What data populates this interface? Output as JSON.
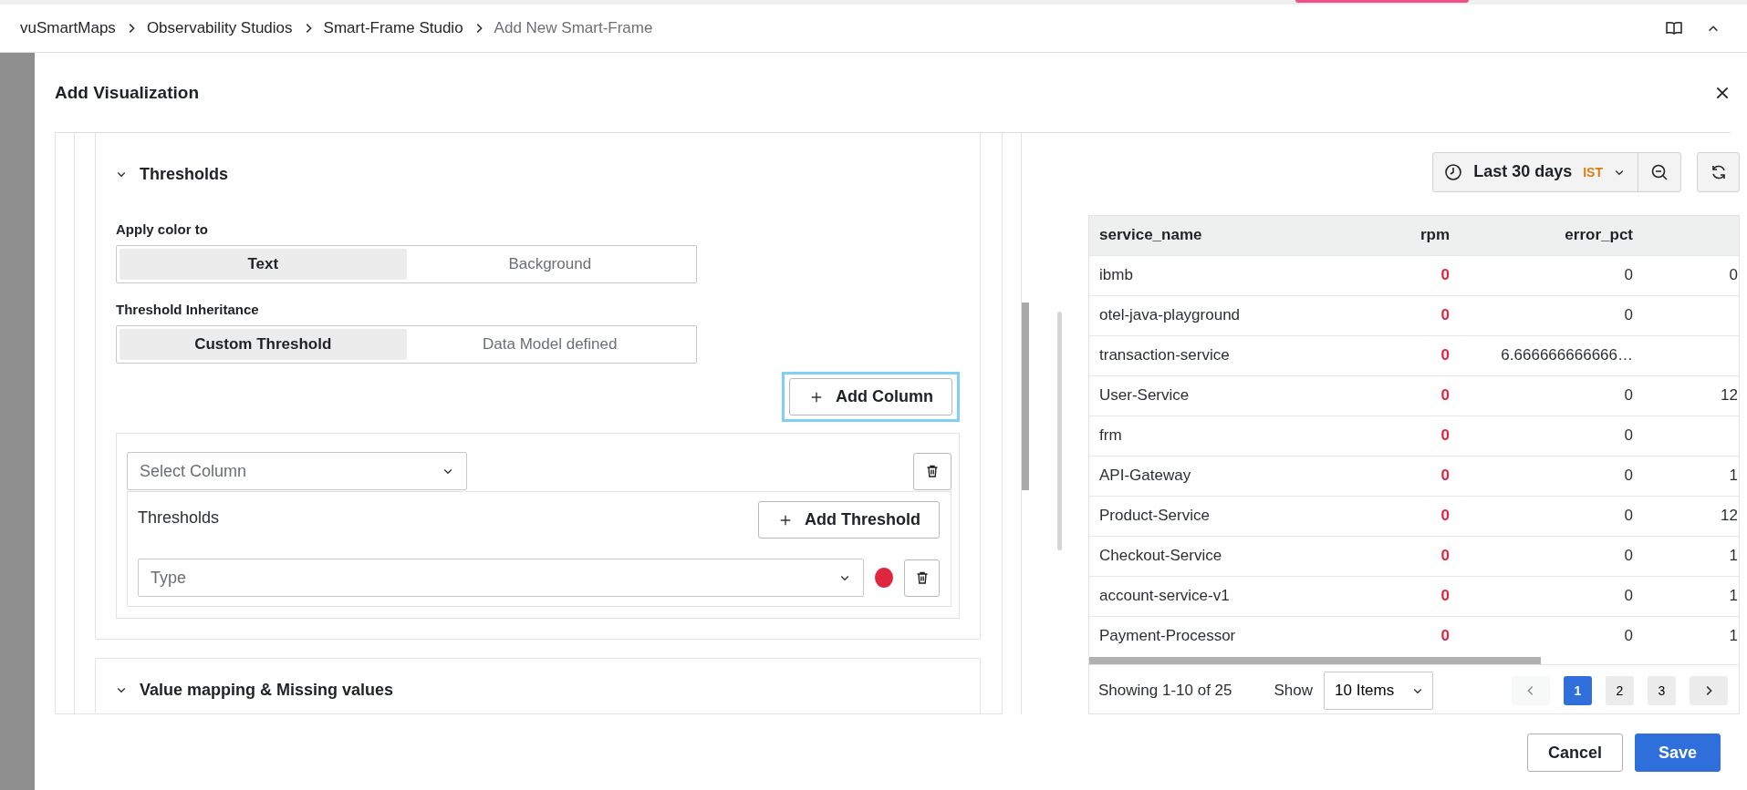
{
  "breadcrumb": {
    "items": [
      {
        "label": "vuSmartMaps",
        "current": false
      },
      {
        "label": "Observability Studios",
        "current": false
      },
      {
        "label": "Smart-Frame Studio",
        "current": false
      },
      {
        "label": "Add New Smart-Frame",
        "current": true
      }
    ]
  },
  "dialog": {
    "title": "Add Visualization"
  },
  "thresholds_section": {
    "title": "Thresholds",
    "apply_color_label": "Apply color to",
    "apply_color_options": [
      {
        "label": "Text",
        "selected": true
      },
      {
        "label": "Background",
        "selected": false
      }
    ],
    "inheritance_label": "Threshold Inheritance",
    "inheritance_options": [
      {
        "label": "Custom Threshold",
        "selected": true
      },
      {
        "label": "Data Model defined",
        "selected": false
      }
    ],
    "add_column": {
      "label": "Add Column",
      "focused": true
    },
    "column_rules": [
      {
        "select_placeholder": "Select Column",
        "thresholds_label": "Thresholds",
        "add_threshold_label": "Add Threshold",
        "thresholds": [
          {
            "placeholder": "Type",
            "color": "#e0263f"
          }
        ]
      }
    ]
  },
  "value_mapping_section": {
    "title": "Value mapping & Missing values"
  },
  "preview": {
    "time_range": {
      "label": "Last 30 days",
      "timezone": "IST"
    },
    "table": {
      "columns": [
        {
          "label": "service_name",
          "highlight": false
        },
        {
          "label": "rpm",
          "highlight": true
        },
        {
          "label": "error_pct",
          "highlight": false
        }
      ],
      "rows": [
        {
          "service_name": "ibmb",
          "rpm": "0",
          "error_pct": "0",
          "column_4": "0"
        },
        {
          "service_name": "otel-java-playground",
          "rpm": "0",
          "error_pct": "0"
        },
        {
          "service_name": "transaction-service",
          "rpm": "0",
          "error_pct": "6.666666666666…"
        },
        {
          "service_name": "User-Service",
          "rpm": "0",
          "error_pct": "0",
          "column_4": "12"
        },
        {
          "service_name": "frm",
          "rpm": "0",
          "error_pct": "0"
        },
        {
          "service_name": "API-Gateway",
          "rpm": "0",
          "error_pct": "0",
          "column_4": "1"
        },
        {
          "service_name": "Product-Service",
          "rpm": "0",
          "error_pct": "0",
          "column_4": "12"
        },
        {
          "service_name": "Checkout-Service",
          "rpm": "0",
          "error_pct": "0",
          "column_4": "1"
        },
        {
          "service_name": "account-service-v1",
          "rpm": "0",
          "error_pct": "0",
          "column_4": "1"
        },
        {
          "service_name": "Payment-Processor",
          "rpm": "0",
          "error_pct": "0",
          "column_4": "1"
        }
      ]
    },
    "pagination": {
      "summary": "Showing 1-10 of 25",
      "show_label": "Show",
      "page_size": "10 Items",
      "prev_disabled": true,
      "next_disabled": false,
      "pages": [
        {
          "label": "1",
          "selected": true
        },
        {
          "label": "2",
          "selected": false
        },
        {
          "label": "3",
          "selected": false
        }
      ]
    }
  },
  "buttons": [
    {
      "label": "Cancel",
      "kind": "secondary"
    },
    {
      "label": "Save",
      "kind": "primary"
    }
  ]
}
